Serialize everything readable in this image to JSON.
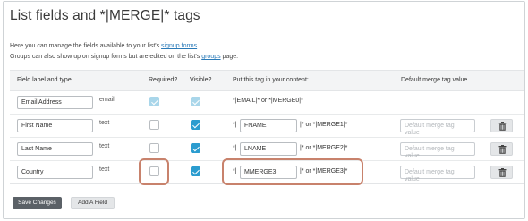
{
  "page": {
    "title": "List fields and *|MERGE|* tags",
    "desc_line1_prefix": "Here you can manage the fields available to your list's ",
    "desc_line1_link": "signup forms",
    "desc_line1_suffix": ".",
    "desc_line2_prefix": "Groups can also show up on signup forms but are edited on the list's ",
    "desc_line2_link": "groups",
    "desc_line2_suffix": " page."
  },
  "table": {
    "headers": {
      "field": "Field label and type",
      "required": "Required?",
      "visible": "Visible?",
      "tag": "Put this tag in your content:",
      "default": "Default merge tag value"
    },
    "rows": [
      {
        "label": "Email Address",
        "type": "email",
        "required": true,
        "visible": true,
        "locked": true,
        "tag_text": "*|EMAIL|* or *|MERGE0|*"
      },
      {
        "label": "First Name",
        "type": "text",
        "required": false,
        "visible": true,
        "tag_prefix": "*|",
        "tag": "FNAME",
        "tag_suffix": "|* or *|MERGE1|*",
        "default_placeholder": "Default merge tag value"
      },
      {
        "label": "Last Name",
        "type": "text",
        "required": false,
        "visible": true,
        "tag_prefix": "*|",
        "tag": "LNAME",
        "tag_suffix": "|* or *|MERGE2|*",
        "default_placeholder": "Default merge tag value"
      },
      {
        "label": "Country",
        "type": "text",
        "required": false,
        "visible": true,
        "tag_prefix": "*|",
        "tag": "MMERGE3",
        "tag_suffix": "|* or *|MERGE3|*",
        "default_placeholder": "Default merge tag value"
      }
    ]
  },
  "actions": {
    "save": "Save Changes",
    "add": "Add A Field"
  },
  "colors": {
    "accent": "#2b9ccf",
    "highlight": "#c8826c",
    "primary_button": "#5b6167"
  }
}
